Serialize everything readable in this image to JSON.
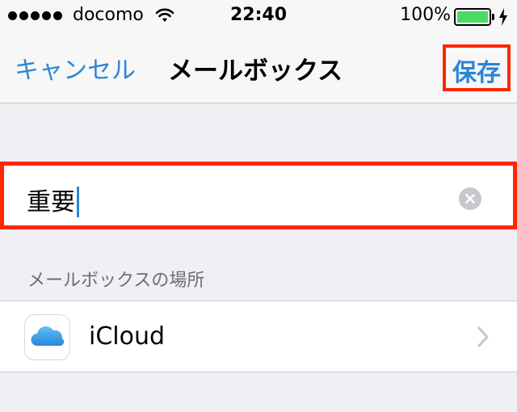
{
  "status": {
    "carrier": "docomo",
    "time": "22:40",
    "battery": "100%",
    "battery_level": 1.0,
    "battery_color": "#4cd964"
  },
  "nav": {
    "cancel": "キャンセル",
    "title": "メールボックス",
    "save": "保存"
  },
  "name_field": {
    "value": "重要"
  },
  "location_section": {
    "header": "メールボックスの場所",
    "item_label": "iCloud",
    "item_icon": "icloud-icon"
  },
  "colors": {
    "accent": "#2a86d8",
    "highlight": "#ff2600",
    "background": "#efeff4"
  }
}
